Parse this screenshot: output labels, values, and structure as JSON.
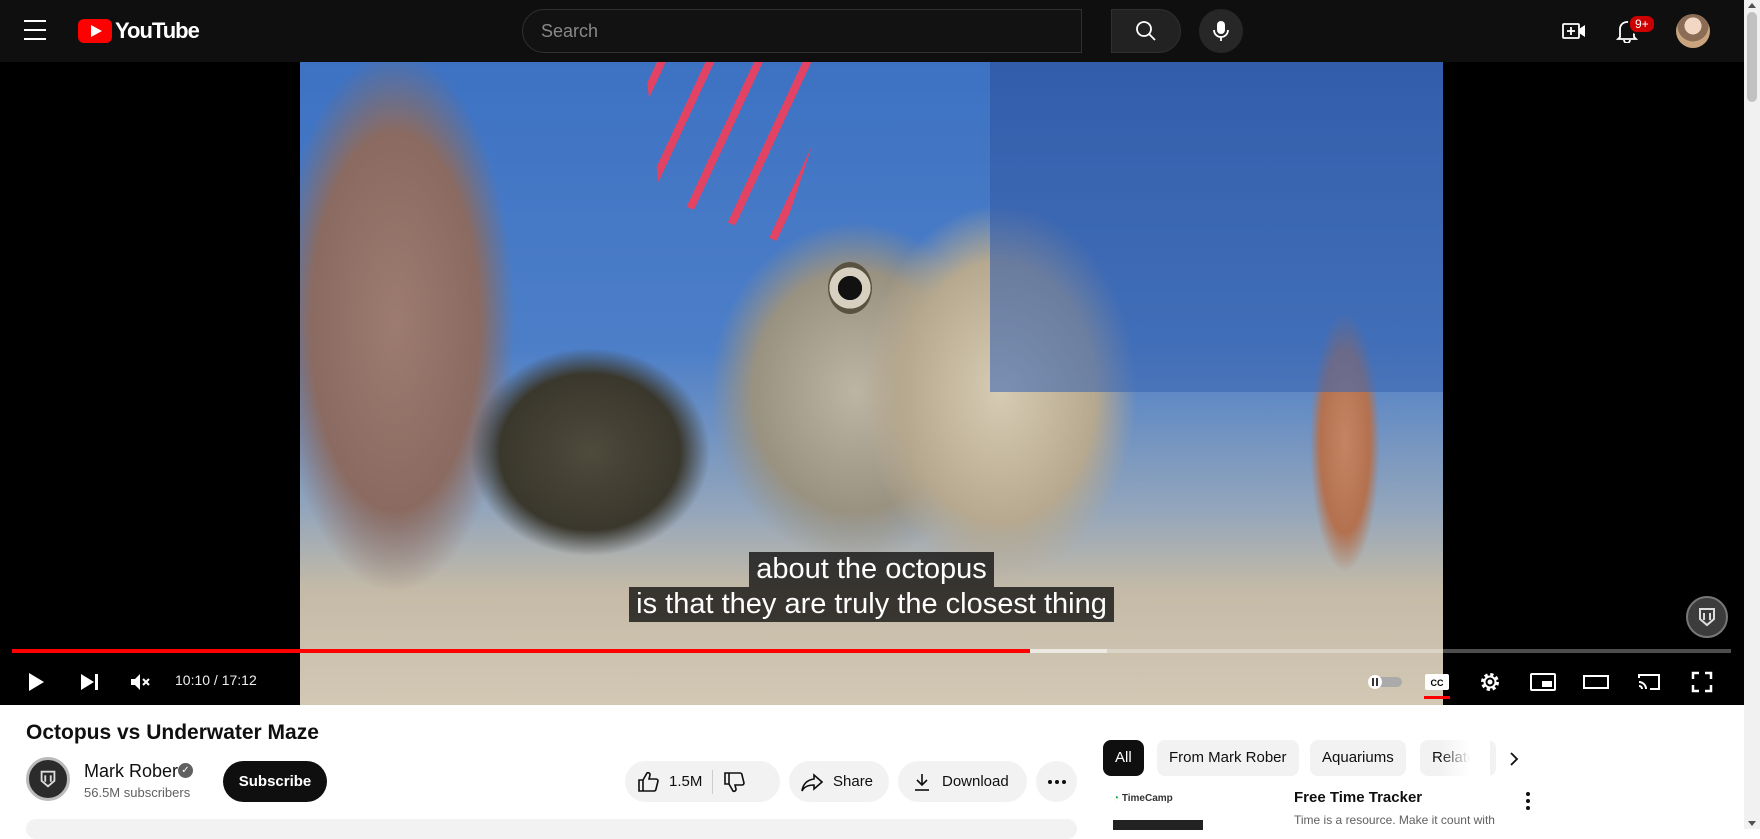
{
  "header": {
    "logo_text": "YouTube",
    "search_placeholder": "Search",
    "notification_count": "9+"
  },
  "player": {
    "captions": [
      "about the octopus",
      "is that they are truly the closest thing"
    ],
    "current_time": "10:10",
    "duration": "17:12",
    "time_display": "10:10 / 17:12",
    "progress_played": 0.592,
    "progress_buffered": 0.637,
    "accent_color": "#ff0000"
  },
  "video": {
    "title": "Octopus vs Underwater Maze",
    "channel_name": "Mark Rober",
    "subscribers": "56.5M subscribers",
    "subscribe_label": "Subscribe",
    "like_count": "1.5M",
    "share_label": "Share",
    "download_label": "Download"
  },
  "chips": [
    "All",
    "From Mark Rober",
    "Aquariums",
    "Related"
  ],
  "ad": {
    "brand": "TimeCamp",
    "title": "Free Time Tracker",
    "description": "Time is a resource. Make it count with"
  }
}
